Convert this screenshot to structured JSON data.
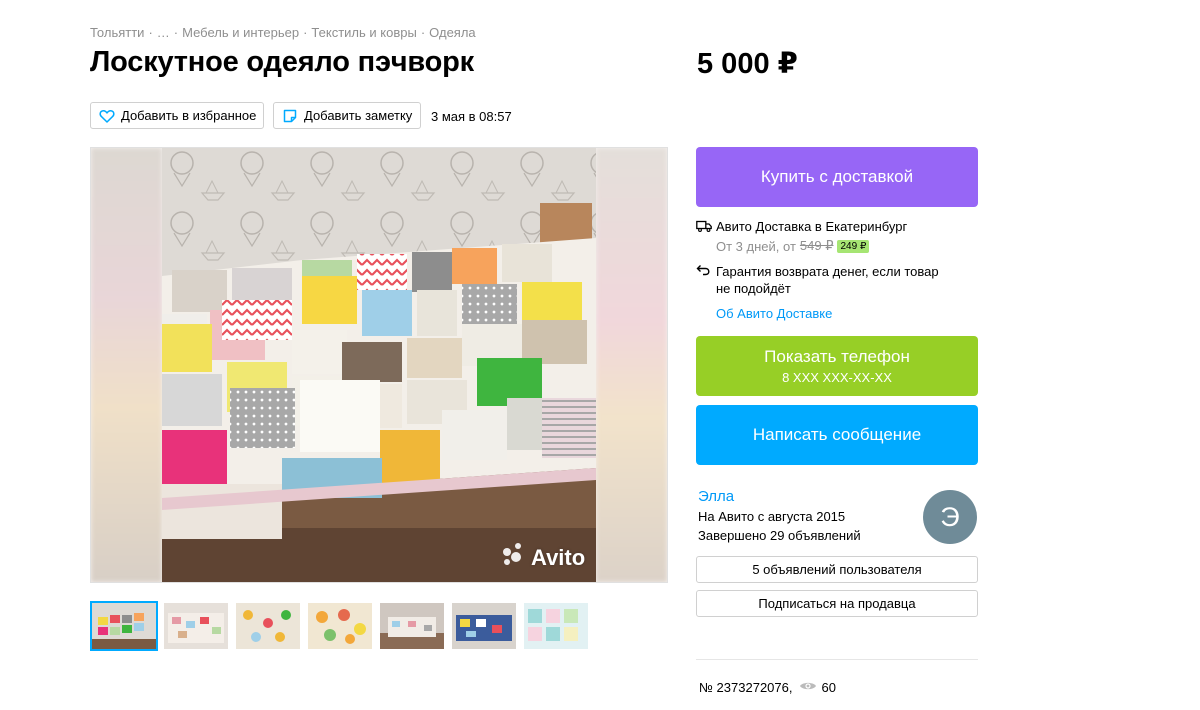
{
  "breadcrumb": [
    "Тольятти",
    "…",
    "Мебель и интерьер",
    "Текстиль и ковры",
    "Одеяла"
  ],
  "breadcrumb_separator": "·",
  "listing": {
    "title": "Лоскутное одеяло пэчворк",
    "price": "5 000 ₽",
    "date": "3 мая в 08:57"
  },
  "actions": {
    "favorite_label": "Добавить в избранное",
    "note_label": "Добавить заметку"
  },
  "gallery": {
    "watermark": "Avito",
    "thumbnail_count": 7,
    "active_index": 0
  },
  "buy": {
    "label": "Купить с доставкой",
    "color": "#9766f6"
  },
  "delivery": {
    "title": "Авито Доставка в Екатеринбург",
    "terms_prefix": "От 3 дней, от",
    "old_price": "549 ₽",
    "new_price": "249 ₽",
    "guarantee": "Гарантия возврата денег, если товар не подойдёт",
    "about_link": "Об Авито Доставке"
  },
  "phone": {
    "label": "Показать телефон",
    "number": "8 XXX XXX-XX-XX",
    "color": "#97cf26"
  },
  "message": {
    "label": "Написать сообщение",
    "color": "#00aaff"
  },
  "seller": {
    "name": "Элла",
    "since": "На Авито с августа 2015",
    "completed": "Завершено 29 объявлений",
    "avatar_letter": "Э"
  },
  "seller_actions": {
    "ads_label": "5 объявлений пользователя",
    "subscribe_label": "Подписаться на продавца"
  },
  "meta": {
    "listing_number": "№ 2373272076,",
    "views": "60"
  }
}
